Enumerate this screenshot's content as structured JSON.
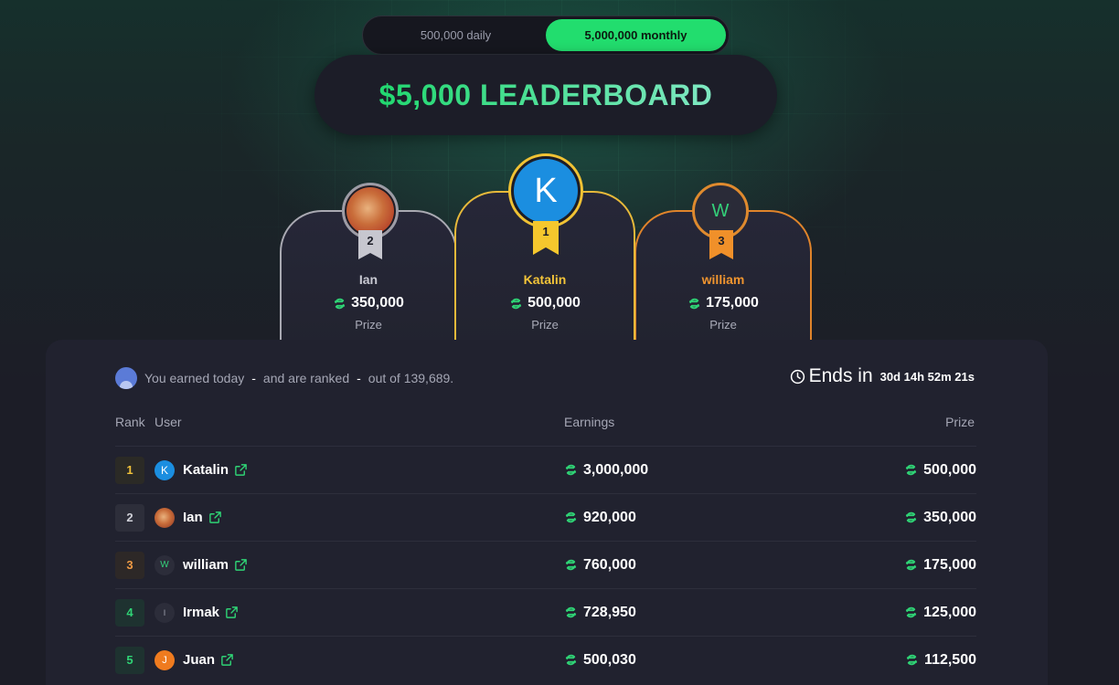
{
  "toggle": {
    "options": [
      "500,000 daily",
      "5,000,000 monthly"
    ],
    "active_index": 1
  },
  "title": "$5,000 LEADERBOARD",
  "podium": [
    {
      "rank": "2",
      "name": "Ian",
      "prize": "350,000",
      "prize_label": "Prize"
    },
    {
      "rank": "1",
      "name": "Katalin",
      "prize": "500,000",
      "prize_label": "Prize",
      "avatar_letter": "K"
    },
    {
      "rank": "3",
      "name": "william",
      "prize": "175,000",
      "prize_label": "Prize",
      "avatar_letter": "W"
    }
  ],
  "status": {
    "prefix": "You earned today",
    "dash1": "-",
    "middle": "and are ranked",
    "dash2": "-",
    "suffix": "out of 139,689.",
    "ends_label": "Ends in",
    "ends_time": "30d 14h 52m 21s"
  },
  "table": {
    "headers": {
      "rank": "Rank",
      "user": "User",
      "earnings": "Earnings",
      "prize": "Prize"
    },
    "rows": [
      {
        "rank": "1",
        "name": "Katalin",
        "avatar": "K",
        "avatar_color": "#1b8ee0",
        "earnings": "3,000,000",
        "prize": "500,000"
      },
      {
        "rank": "2",
        "name": "Ian",
        "avatar": "",
        "avatar_color": "#c9622f",
        "earnings": "920,000",
        "prize": "350,000"
      },
      {
        "rank": "3",
        "name": "william",
        "avatar": "W",
        "avatar_color": "#2c2d3a",
        "earnings": "760,000",
        "prize": "175,000"
      },
      {
        "rank": "4",
        "name": "Irmak",
        "avatar": "I",
        "avatar_color": "#2c2d3a",
        "earnings": "728,950",
        "prize": "125,000"
      },
      {
        "rank": "5",
        "name": "Juan",
        "avatar": "J",
        "avatar_color": "#ef7b1f",
        "earnings": "500,030",
        "prize": "112,500"
      }
    ]
  },
  "colors": {
    "accent": "#22dd6e",
    "gold": "#f0c234",
    "silver": "#a9a9b2",
    "bronze": "#e0842b"
  }
}
